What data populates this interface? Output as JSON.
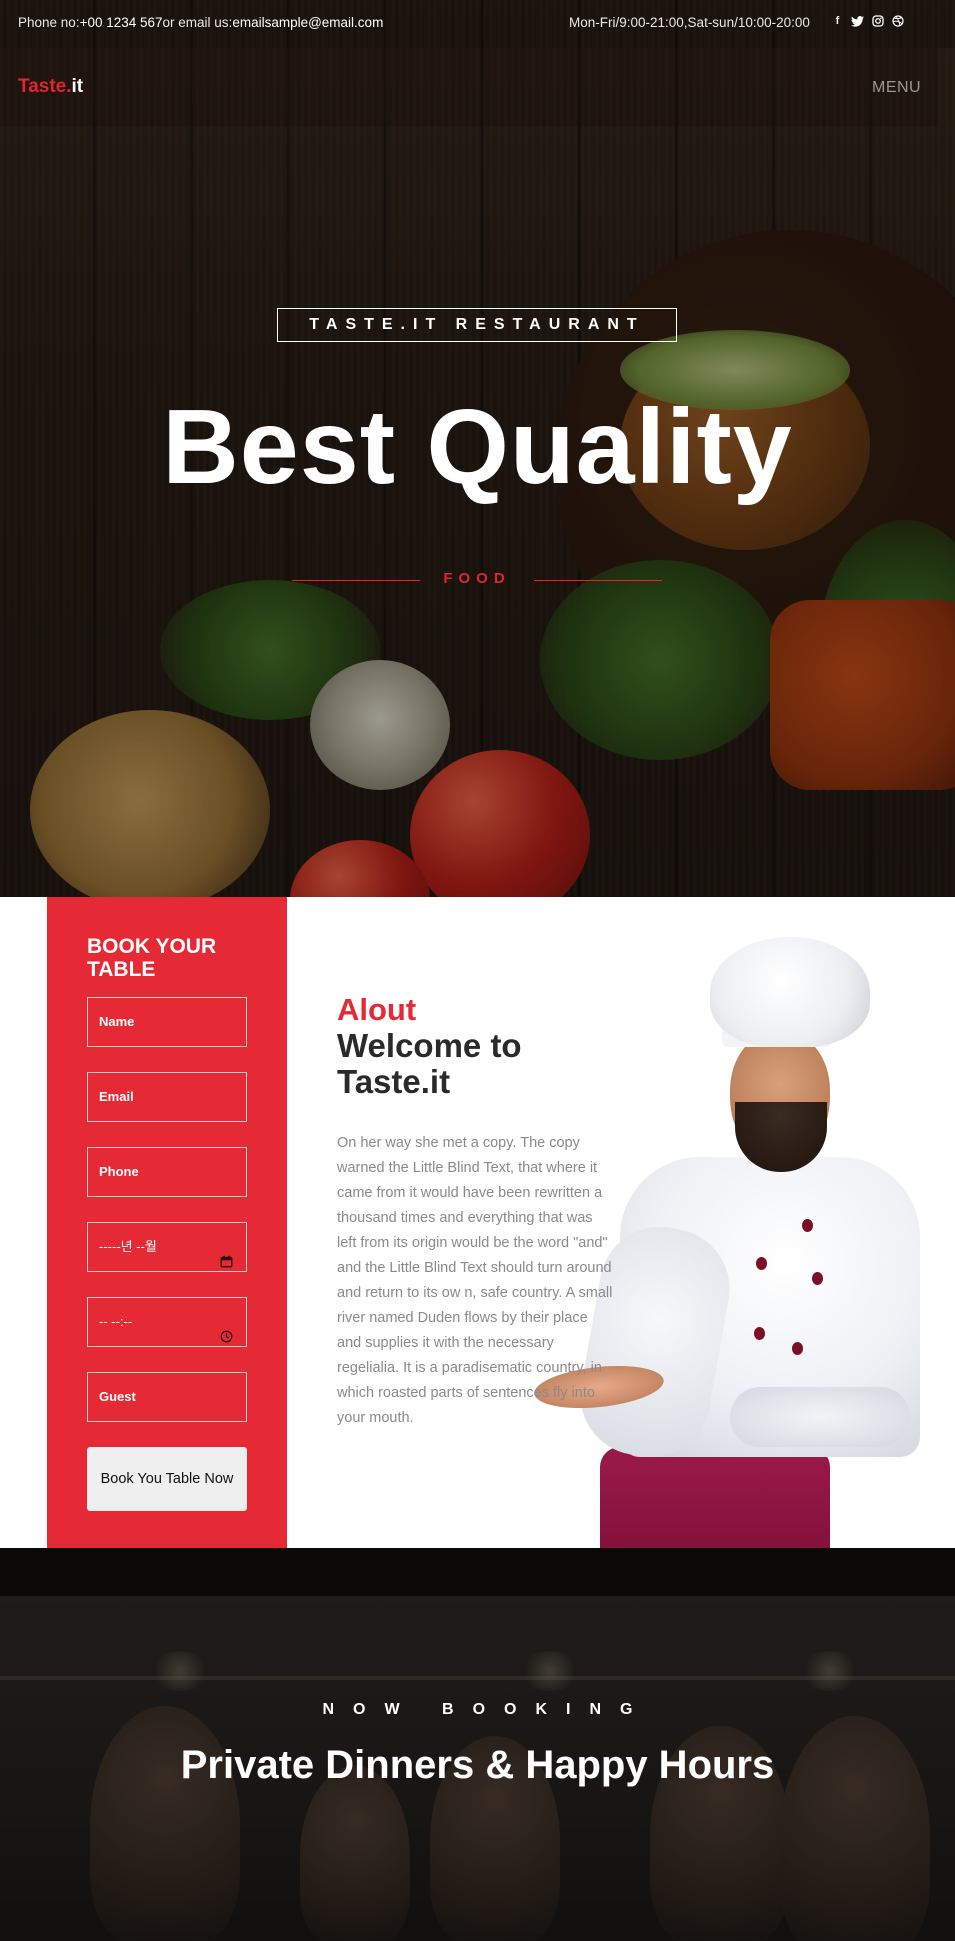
{
  "topbar": {
    "contact_prefix": "Phone no:",
    "phone": "+00 1234 567",
    "email_prefix": "or email us:",
    "email": "emailsample@email.com",
    "hours": "Mon-Fri/9:00-21:00,Sat-sun/10:00-20:00",
    "social": [
      {
        "icon": "facebook-icon",
        "glyph": "f"
      },
      {
        "icon": "twitter-icon",
        "glyph": "🐦"
      },
      {
        "icon": "instagram-icon",
        "glyph": "◎"
      },
      {
        "icon": "dribbble-icon",
        "glyph": "⊕"
      }
    ]
  },
  "navbar": {
    "logo_main": "Taste.",
    "logo_suffix": "it",
    "menu_label": "MENU"
  },
  "hero": {
    "eyebrow": "TASTE.IT RESTAURANT",
    "headline": "Best Quality",
    "subline": "FOOD"
  },
  "booking_form": {
    "title": "BOOK YOUR TABLE",
    "name_placeholder": "Name",
    "email_placeholder": "Email",
    "phone_placeholder": "Phone",
    "date_value": "-----년 --월",
    "time_value": "-- --:--",
    "guest_placeholder": "Guest",
    "submit_label": "Book You Table Now"
  },
  "about": {
    "kicker": "Alout",
    "title_line1": "Welcome to",
    "title_line2": "Taste.it",
    "body": "On her way she met a copy. The copy warned the Little Blind Text, that where it came from it would have been rewritten a thousand times and everything that was left from its origin would be the word \"and\" and the Little Blind Text should turn around and return to its ow n, safe country. A small river named Duden flows by their place and supplies it with the necessary regelialia. It is a paradisematic country, in which roasted parts of sentences fly into your mouth."
  },
  "now_booking": {
    "eyebrow": "NOW BOOKING",
    "title": "Private Dinners & Happy Hours"
  },
  "colors": {
    "accent": "#e52a36",
    "dark": "#141210",
    "text_body": "#8a8a8a"
  }
}
